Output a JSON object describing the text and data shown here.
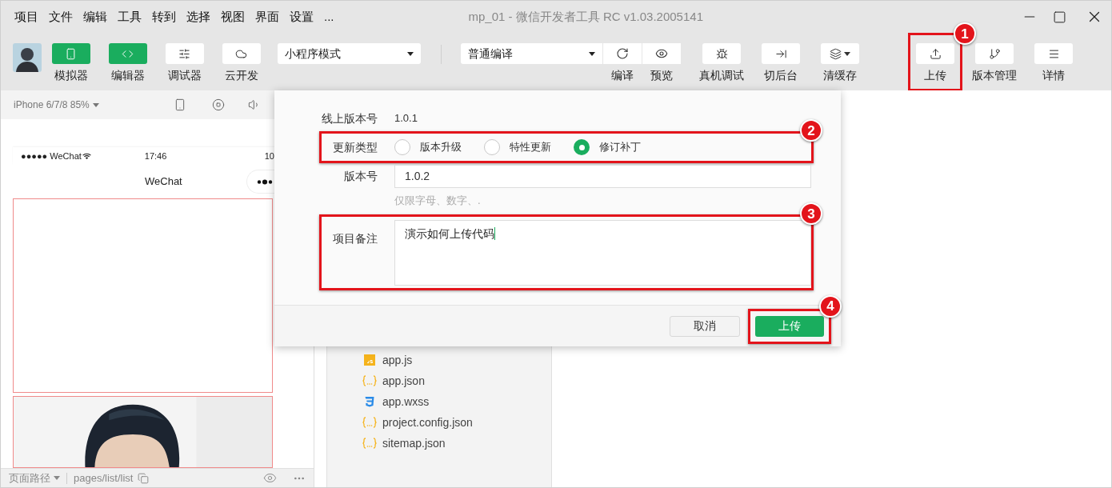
{
  "menu": [
    "项目",
    "文件",
    "编辑",
    "工具",
    "转到",
    "选择",
    "视图",
    "界面",
    "设置",
    "..."
  ],
  "window": {
    "title": "mp_01 - 微信开发者工具 RC v1.03.2005141"
  },
  "toolbar": [
    {
      "kind": "toggle",
      "label": "模拟器",
      "on": true
    },
    {
      "kind": "toggle",
      "label": "编辑器",
      "on": true
    },
    {
      "kind": "toggle",
      "label": "调试器",
      "on": false
    },
    {
      "kind": "toggle",
      "label": "云开发",
      "on": false
    },
    {
      "kind": "select",
      "value": "小程序模式"
    },
    {
      "kind": "divider"
    },
    {
      "kind": "group",
      "value": "普通编译",
      "buttons": [
        {
          "label": "编译"
        },
        {
          "label": "预览"
        }
      ]
    },
    {
      "kind": "button",
      "label": "真机调试"
    },
    {
      "kind": "button",
      "label": "切后台"
    },
    {
      "kind": "button",
      "label": "清缓存",
      "dropdown": true
    },
    {
      "kind": "button",
      "label": "上传",
      "callout": "1"
    },
    {
      "kind": "button",
      "label": "版本管理"
    },
    {
      "kind": "button",
      "label": "详情"
    }
  ],
  "simulator": {
    "device": "iPhone 6/7/8 85%",
    "carrier": "●●●●● WeChat",
    "time": "17:46",
    "battery": "10",
    "nav_title": "WeChat",
    "path_label": "页面路径",
    "path": "pages/list/list"
  },
  "files": [
    {
      "name": "app.js",
      "kind": "js"
    },
    {
      "name": "app.json",
      "kind": "json"
    },
    {
      "name": "app.wxss",
      "kind": "wxss"
    },
    {
      "name": "project.config.json",
      "kind": "json"
    },
    {
      "name": "sitemap.json",
      "kind": "json"
    }
  ],
  "upload_dialog": {
    "online_version": {
      "label": "线上版本号",
      "value": "1.0.1"
    },
    "update_type": {
      "label": "更新类型",
      "callout": "2",
      "options": [
        {
          "label": "版本升级",
          "selected": false
        },
        {
          "label": "特性更新",
          "selected": false
        },
        {
          "label": "修订补丁",
          "selected": true
        }
      ]
    },
    "version": {
      "label": "版本号",
      "value": "1.0.2",
      "hint": "仅限字母、数字、."
    },
    "note": {
      "label": "项目备注",
      "value": "演示如何上传代码",
      "callout": "3"
    },
    "buttons": [
      {
        "label": "取消",
        "kind": "secondary"
      },
      {
        "label": "上传",
        "kind": "primary",
        "callout": "4"
      }
    ]
  }
}
